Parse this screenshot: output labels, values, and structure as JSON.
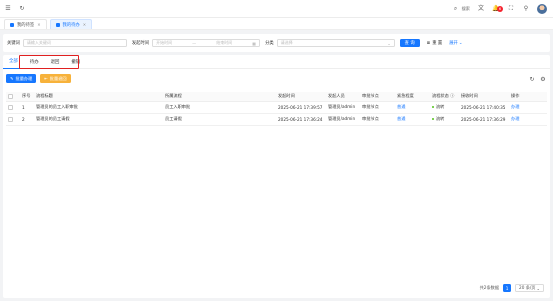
{
  "header": {
    "search_label": "搜索",
    "notification_count": "6"
  },
  "tabs": [
    {
      "label": "我的待签"
    },
    {
      "label": "我的待办"
    }
  ],
  "filter": {
    "keyword_label": "关键词",
    "keyword_placeholder": "请输入关键词",
    "time_label": "发起时间",
    "start_placeholder": "开始时间",
    "range_sep": "—",
    "end_placeholder": "结束时间",
    "category_label": "分类",
    "category_placeholder": "请选择",
    "query_button": "查 询",
    "reset_button": "重 置",
    "expand_button": "展开"
  },
  "sub_tabs": [
    "全部",
    "待办",
    "退回",
    "撤销"
  ],
  "actions": {
    "batch_handle": "批量办理",
    "batch_return": "批量退回"
  },
  "table": {
    "headers": [
      "序号",
      "流程标题",
      "所属流程",
      "发起时间",
      "发起人员",
      "审批节点",
      "紧急程度",
      "流程状态",
      "接收时间",
      "操作"
    ],
    "rows": [
      {
        "index": "1",
        "title": "管理员的员工入职审批",
        "flow": "员工入职审批",
        "start_time": "2025-06-21 17:39:57",
        "initiator": "管理员/admin",
        "node": "审批节点",
        "urgency": "普通",
        "status": "流转",
        "recv_time": "2025-06-21 17:40:35",
        "op": "办理"
      },
      {
        "index": "2",
        "title": "管理员的员工请假",
        "flow": "员工请假",
        "start_time": "2025-06-21 17:36:24",
        "initiator": "管理员/admin",
        "node": "审批节点",
        "urgency": "普通",
        "status": "流转",
        "recv_time": "2025-06-21 17:36:29",
        "op": "办理"
      }
    ]
  },
  "pager": {
    "total": "共2条数据",
    "current": "1",
    "size": "20 条/页"
  },
  "colors": {
    "primary": "#1677ff",
    "orange": "#f7b23b",
    "highlight": "#e02020",
    "status_green": "#52c41a"
  }
}
